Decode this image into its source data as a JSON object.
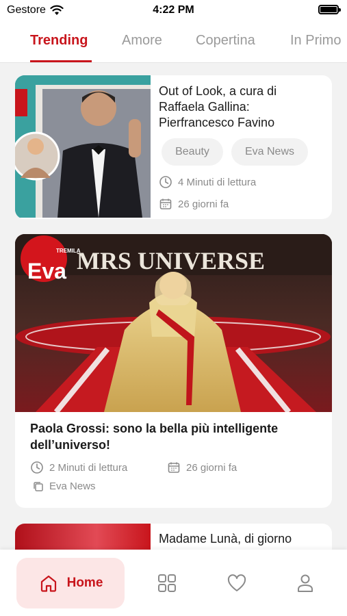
{
  "status_bar": {
    "carrier": "Gestore",
    "time": "4:22 PM"
  },
  "tabs": [
    {
      "label": "Trending",
      "active": true
    },
    {
      "label": "Amore",
      "active": false
    },
    {
      "label": "Copertina",
      "active": false
    },
    {
      "label": "In Primo",
      "active": false
    }
  ],
  "articles": [
    {
      "title": "Out of Look, a cura  di Raffaela Gallina: Pierfrancesco Favino",
      "tags": [
        "Beauty",
        "Eva News"
      ],
      "reading_time": "4 Minuti di lettura",
      "date": "26 giorni fa"
    },
    {
      "image_text": {
        "logo": "Eva",
        "logo_small": "TREMILA",
        "banner": "MRS UNIVERSE"
      },
      "title": "Paola Grossi: sono la bella più intelligente dell’universo!",
      "reading_time": "2 Minuti di lettura",
      "date": "26 giorni fa",
      "category": "Eva News"
    },
    {
      "title": "Madame Lunà, di giorno"
    }
  ],
  "bottom_nav": {
    "home_label": "Home",
    "icons": [
      "home-icon",
      "grid-icon",
      "heart-icon",
      "profile-icon"
    ]
  },
  "colors": {
    "accent": "#c8151c",
    "accent_light": "#fce6e6",
    "muted": "#8a8a8a",
    "background": "#f2f2f2"
  }
}
